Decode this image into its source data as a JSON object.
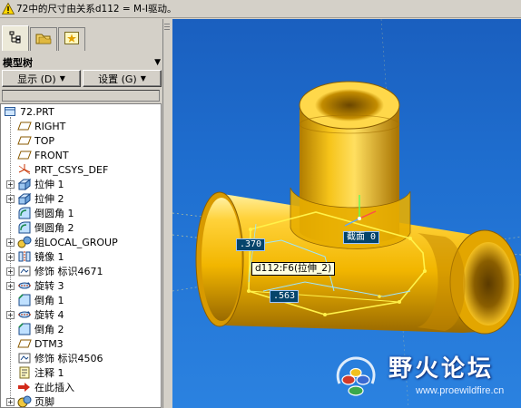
{
  "message_bar": {
    "text": "72中的尺寸由关系d112 = M-I驱动。",
    "icon": "warning-icon"
  },
  "left_panel": {
    "tabs": [
      {
        "name": "model-tree-tab",
        "icon": "model-tree-icon"
      },
      {
        "name": "folder-tab",
        "icon": "folder-icon"
      },
      {
        "name": "favorites-tab",
        "icon": "favorites-icon"
      }
    ],
    "title": "模型树",
    "display_button": "显示 (D)",
    "settings_button": "设置 (G)"
  },
  "tree": {
    "items": [
      {
        "label": "72.PRT",
        "icon": "part-icon",
        "expand": false,
        "level": 0
      },
      {
        "label": "RIGHT",
        "icon": "datum-plane-icon",
        "expand": false,
        "level": 1
      },
      {
        "label": "TOP",
        "icon": "datum-plane-icon",
        "expand": false,
        "level": 1
      },
      {
        "label": "FRONT",
        "icon": "datum-plane-icon",
        "expand": false,
        "level": 1
      },
      {
        "label": "PRT_CSYS_DEF",
        "icon": "csys-icon",
        "expand": false,
        "level": 1
      },
      {
        "label": "拉伸 1",
        "icon": "extrude-icon",
        "expand": true,
        "level": 1
      },
      {
        "label": "拉伸 2",
        "icon": "extrude-icon",
        "expand": true,
        "level": 1
      },
      {
        "label": "倒圆角 1",
        "icon": "round-icon",
        "expand": false,
        "level": 1
      },
      {
        "label": "倒圆角 2",
        "icon": "round-icon",
        "expand": false,
        "level": 1
      },
      {
        "label": "组LOCAL_GROUP",
        "icon": "group-icon",
        "expand": true,
        "level": 1
      },
      {
        "label": "镜像 1",
        "icon": "mirror-icon",
        "expand": true,
        "level": 1
      },
      {
        "label": "修饰 标识4671",
        "icon": "cosmetic-icon",
        "expand": true,
        "level": 1
      },
      {
        "label": "旋转 3",
        "icon": "revolve-icon",
        "expand": true,
        "level": 1
      },
      {
        "label": "倒角 1",
        "icon": "chamfer-icon",
        "expand": false,
        "level": 1
      },
      {
        "label": "旋转 4",
        "icon": "revolve-icon",
        "expand": true,
        "level": 1
      },
      {
        "label": "倒角 2",
        "icon": "chamfer-icon",
        "expand": false,
        "level": 1
      },
      {
        "label": "DTM3",
        "icon": "datum-plane-icon",
        "expand": false,
        "level": 1
      },
      {
        "label": "修饰 标识4506",
        "icon": "cosmetic-icon",
        "expand": false,
        "level": 1
      },
      {
        "label": "注释 1",
        "icon": "note-icon",
        "expand": false,
        "level": 1
      },
      {
        "label": "在此插入",
        "icon": "insert-here-icon",
        "expand": false,
        "level": 1
      },
      {
        "label": "页脚",
        "icon": "footer-icon",
        "expand": true,
        "level": 1
      }
    ]
  },
  "viewport": {
    "dimensions": [
      {
        "name": "dim-370",
        "text": ".370"
      },
      {
        "name": "dim-563",
        "text": ".563"
      },
      {
        "name": "dim-sec",
        "text": "截面 0"
      }
    ],
    "tooltip": "d112:F6(拉伸_2)"
  },
  "watermark": {
    "title": "野火论坛",
    "url": "www.proewildfire.cn"
  },
  "colors": {
    "viewport_bg": "#1f6fd0",
    "part_body": "#f2b600",
    "part_shadow": "#b88000",
    "selection": "#fff24a"
  }
}
